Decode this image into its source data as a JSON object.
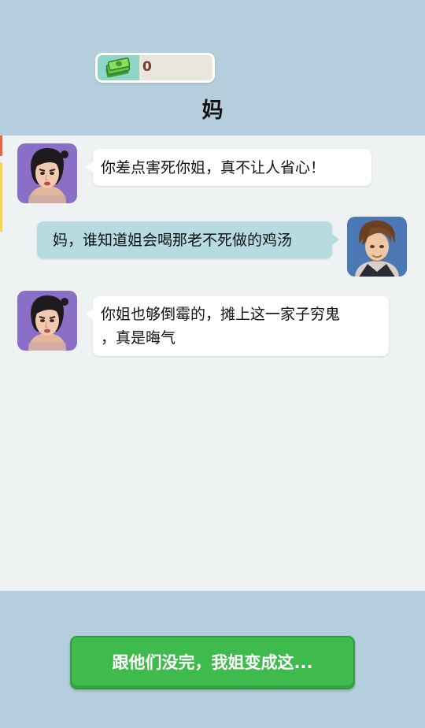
{
  "header": {
    "money": {
      "icon": "cash-stack-icon",
      "value": "0"
    },
    "contact_name": "妈"
  },
  "messages": [
    {
      "sender": "mom",
      "side": "left",
      "lines": [
        "你差点害死你姐，真不让人省心！"
      ]
    },
    {
      "sender": "player",
      "side": "right",
      "lines": [
        "妈，谁知道姐会喝那老不死做的鸡汤"
      ]
    },
    {
      "sender": "mom",
      "side": "left",
      "lines": [
        "你姐也够倒霉的，摊上这一家子穷鬼",
        "，真是晦气"
      ]
    }
  ],
  "reply": {
    "label": "跟他们没完，我姐变成这..."
  },
  "colors": {
    "background": "#b5cedd",
    "chat_background": "#eff2f2",
    "incoming_bubble": "#ffffff",
    "outgoing_bubble": "#b6dbe0",
    "reply_button": "#3fba4c",
    "money_icon_bg": "#8fd6c8"
  }
}
